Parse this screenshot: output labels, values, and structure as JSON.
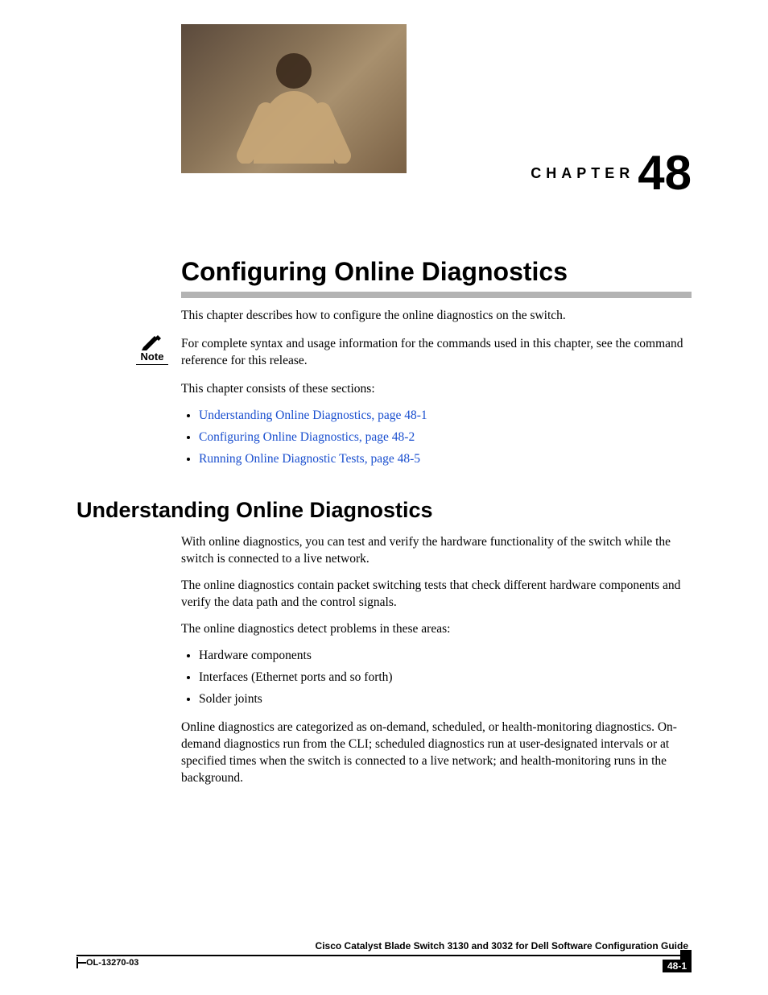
{
  "chapter": {
    "label": "CHAPTER",
    "number": "48"
  },
  "title": "Configuring Online Diagnostics",
  "intro": "This chapter describes how to configure the online diagnostics on the switch.",
  "note": {
    "label": "Note",
    "text": "For complete syntax and usage information for the commands used in this chapter, see the command reference for this release."
  },
  "sections_lead": "This chapter consists of these sections:",
  "toc": [
    "Understanding Online Diagnostics, page 48-1",
    "Configuring Online Diagnostics, page 48-2",
    "Running Online Diagnostic Tests, page 48-5"
  ],
  "h2": "Understanding Online Diagnostics",
  "para1": "With online diagnostics, you can test and verify the hardware functionality of the switch while the switch is connected to a live network.",
  "para2": "The online diagnostics contain packet switching tests that check different hardware components and verify the data path and the control signals.",
  "para3": "The online diagnostics detect problems in these areas:",
  "areas": [
    "Hardware components",
    "Interfaces (Ethernet ports and so forth)",
    "Solder joints"
  ],
  "para4": "Online diagnostics are categorized as on-demand, scheduled, or health-monitoring diagnostics. On-demand diagnostics run from the CLI; scheduled diagnostics run at user-designated intervals or at specified times when the switch is connected to a live network; and health-monitoring runs in the background.",
  "footer": {
    "guide": "Cisco Catalyst Blade Switch 3130 and 3032 for Dell Software Configuration Guide",
    "docid": "OL-13270-03",
    "pagenum": "48-1"
  }
}
